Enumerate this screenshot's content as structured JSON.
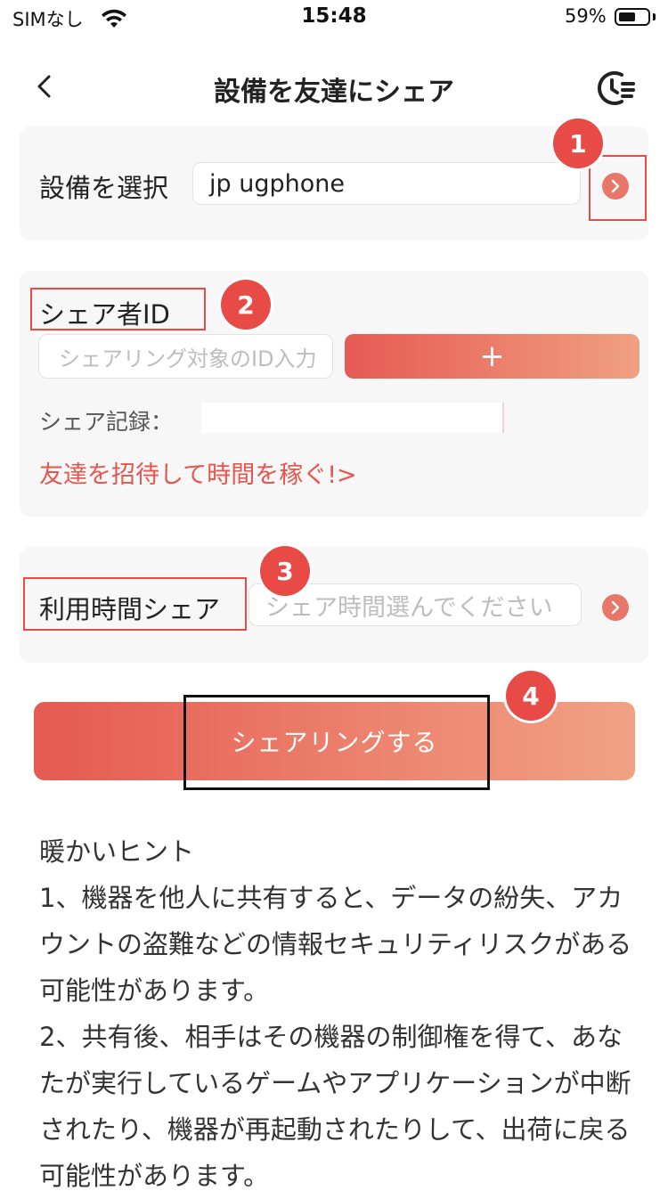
{
  "status_bar": {
    "carrier": "SIMなし",
    "time": "15:48",
    "battery_percent": "59%",
    "battery_level": 0.59
  },
  "nav": {
    "title": "設備を友達にシェア"
  },
  "device_section": {
    "label": "設備を選択",
    "value": "jp ugphone",
    "badge": "1"
  },
  "share_id_section": {
    "label": "シェア者ID",
    "badge": "2",
    "id_placeholder": "シェアリング対象のID入力",
    "add_label": "+",
    "record_label": "シェア記録：",
    "record_value": "",
    "invite_link": "友達を招待して時間を稼ぐ!>"
  },
  "time_section": {
    "label": "利用時間シェア",
    "badge": "3",
    "time_placeholder": "シェア時間選んでください"
  },
  "share_button": {
    "label": "シェアリングする",
    "badge": "4"
  },
  "tips": {
    "title": "暖かいヒント",
    "items": [
      "1、機器を他人に共有すると、データの紛失、アカウントの盗難などの情報セキュリティリスクがある可能性があります。",
      "2、共有後、相手はその機器の制御権を得て、あなたが実行しているゲームやアプリケーションが中断されたり、機器が再起動されたりして、出荷に戻る可能性があります。"
    ]
  },
  "colors": {
    "accent": "#e84a45",
    "gradient_start": "#e55a52",
    "gradient_end": "#f1a284",
    "card_bg": "#f7f7f7"
  }
}
